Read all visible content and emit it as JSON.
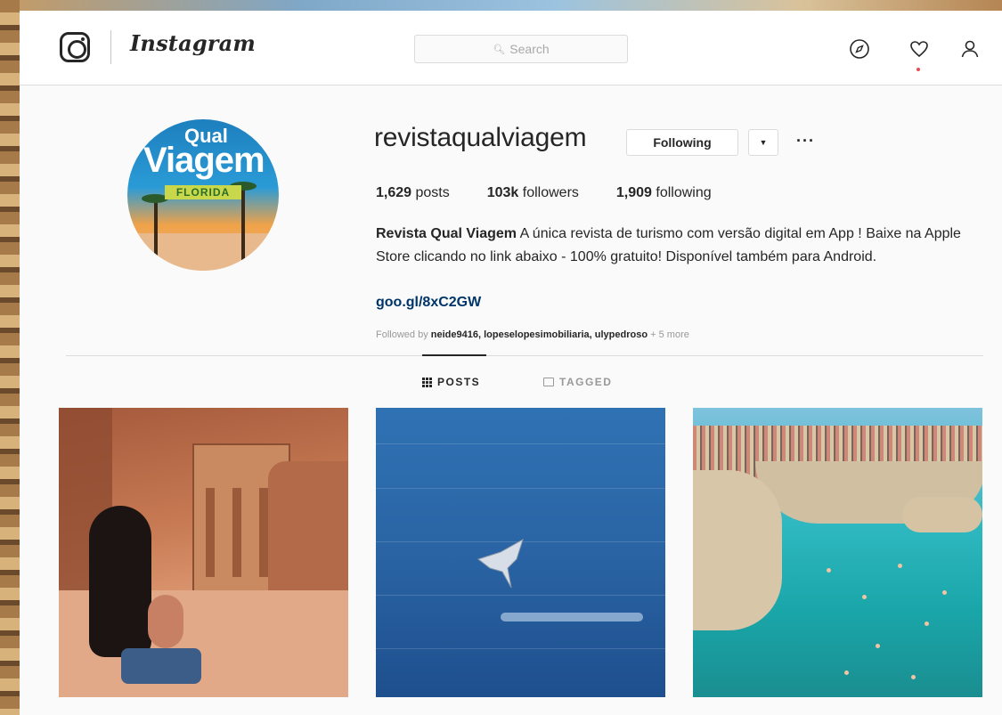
{
  "app": {
    "wordmark": "Instagram",
    "colors": {
      "link": "#003569",
      "notification": "#ed4956",
      "text": "#262626",
      "muted": "#999999",
      "border": "#dbdbdb"
    }
  },
  "topbar": {
    "search_placeholder": "Search",
    "icons": [
      "instagram-glyph-icon",
      "search-icon",
      "compass-icon",
      "heart-icon",
      "person-icon"
    ]
  },
  "profile": {
    "username": "revistaqualviagem",
    "following_label": "Following",
    "avatar_text": {
      "line1": "Qual",
      "line2": "Viagem",
      "tag": "FLORIDA"
    },
    "stats": {
      "posts_count": "1,629",
      "posts_label": " posts",
      "followers_count": "103k",
      "followers_label": " followers",
      "following_count": "1,909",
      "following_label": " following"
    },
    "bio_name": "Revista Qual Viagem",
    "bio_text": " A única revista de turismo com versão digital em App ! Baixe na Apple Store clicando no link abaixo - 100% gratuito! Disponível também para Android.",
    "link": "goo.gl/8xC2GW",
    "followed_by_prefix": "Followed by ",
    "followed_by_names": "neide9416, lopeselopesimobiliaria, ulypedroso",
    "followed_by_more": " + 5 more"
  },
  "tabs": [
    {
      "label": "POSTS",
      "active": true
    },
    {
      "label": "TAGGED",
      "active": false
    }
  ]
}
